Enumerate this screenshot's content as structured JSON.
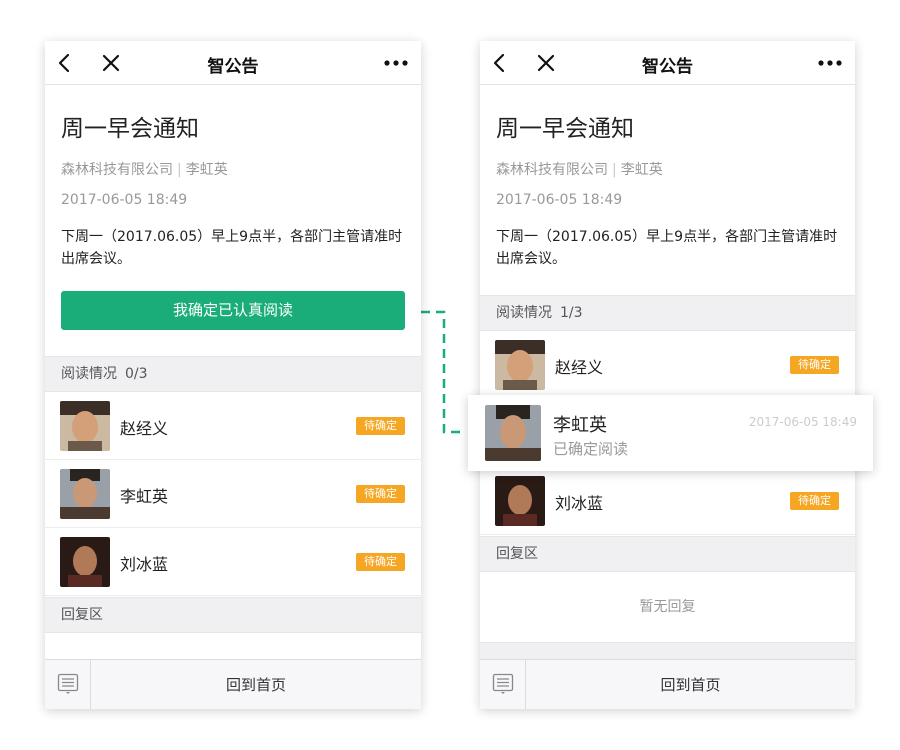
{
  "nav": {
    "title": "智公告",
    "back_icon": "chevron-left-icon",
    "close_icon": "close-icon",
    "more_icon": "more-dots-icon"
  },
  "announcement": {
    "title": "周一早会通知",
    "company": "森林科技有限公司",
    "separator": "|",
    "author": "李虹英",
    "time": "2017-06-05 18:49",
    "body": "下周一（2017.06.05）早上9点半，各部门主管请准时出席会议。"
  },
  "left": {
    "confirm_button": "我确定已认真阅读",
    "read_section": {
      "label": "阅读情况",
      "count": "0/3"
    },
    "readers": [
      {
        "name": "赵经义",
        "status": "待确定"
      },
      {
        "name": "李虹英",
        "status": "待确定"
      },
      {
        "name": "刘冰蓝",
        "status": "待确定"
      }
    ],
    "reply_section": "回复区"
  },
  "right": {
    "read_section": {
      "label": "阅读情况",
      "count": "1/3"
    },
    "readers": [
      {
        "name": "赵经义",
        "status": "待确定"
      },
      {
        "name": "刘冰蓝",
        "status": "待确定"
      }
    ],
    "reply_section": "回复区",
    "reply_empty": "暂无回复"
  },
  "popout": {
    "name": "李虹英",
    "status": "已确定阅读",
    "time": "2017-06-05 18:49"
  },
  "bottom_bar": {
    "icon": "list-menu-icon",
    "home_label": "回到首页"
  },
  "colors": {
    "accent_green": "#1aad7a",
    "pending_badge": "#f5a623",
    "section_bg": "#f0f0f3"
  }
}
